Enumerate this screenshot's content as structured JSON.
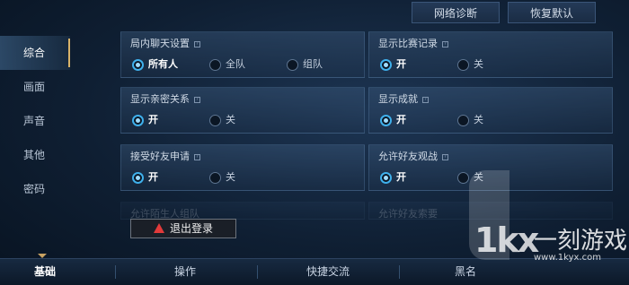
{
  "top_buttons": {
    "network": "网络诊断",
    "reset": "恢复默认"
  },
  "nav": [
    "综合",
    "画面",
    "声音",
    "其他",
    "密码"
  ],
  "info_glyph": "?",
  "panels": {
    "chat": {
      "title": "局内聊天设置",
      "options": [
        "所有人",
        "全队",
        "组队"
      ]
    },
    "match_record": {
      "title": "显示比赛记录",
      "options": [
        "开",
        "关"
      ]
    },
    "intimacy": {
      "title": "显示亲密关系",
      "options": [
        "开",
        "关"
      ]
    },
    "achievements": {
      "title": "显示成就",
      "options": [
        "开",
        "关"
      ]
    },
    "friend_request": {
      "title": "接受好友申请",
      "options": [
        "开",
        "关"
      ]
    },
    "spectate": {
      "title": "允许好友观战",
      "options": [
        "开",
        "关"
      ]
    },
    "stranger_team": {
      "title": "允许陌生人组队"
    },
    "friend_gift": {
      "title": "允许好友索要"
    }
  },
  "logout": "退出登录",
  "tabs": [
    "基础",
    "操作",
    "快捷交流",
    "黑名"
  ],
  "watermark": {
    "logo": "1kx",
    "name": "一刻游戏网",
    "url": "www.1kyx.com"
  },
  "colors": {
    "accent": "#3fb0ec",
    "active_nav_bar": "#d9b46a",
    "warning": "#e23a3a"
  }
}
